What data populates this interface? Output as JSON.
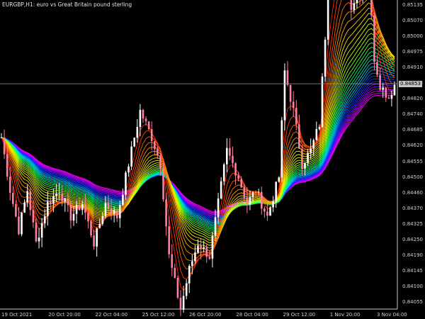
{
  "window": {
    "symbol_timeframe": "EURGBP,H1:",
    "description": "euro vs Great Britain pound sterling"
  },
  "current_price_label": "0.84853",
  "colors": {
    "background": "#000000",
    "axis": "#c8c8c8",
    "text": "#d0d0d0",
    "bull_candle": "#ffffff",
    "bear_candle": "#ff7f9f",
    "ribbon": [
      "#ff00ff",
      "#9900ff",
      "#0033ff",
      "#00ccff",
      "#00ff66",
      "#aaff00",
      "#ffee00",
      "#ff8800",
      "#ff2200"
    ]
  },
  "chart_data": {
    "type": "candlestick_with_ma_ribbon",
    "y_range": [
      0.84,
      0.8517
    ],
    "price_ticks": [
      "0.85135",
      "0.85070",
      "0.85000",
      "0.84975",
      "0.84910",
      "0.84853",
      "0.84820",
      "0.84740",
      "0.84685",
      "0.84620",
      "0.84555",
      "0.84500",
      "0.84460",
      "0.84370",
      "0.84325",
      "0.84250",
      "0.84190",
      "0.84145",
      "0.84100",
      "0.84055"
    ],
    "time_ticks": [
      "19 Oct 2021",
      "20 Oct 20:00",
      "22 Oct 04:00",
      "25 Oct 12:00",
      "26 Oct 20:00",
      "28 Oct 04:00",
      "29 Oct 12:00",
      "1 Nov 20:00",
      "3 Nov 04:00"
    ],
    "current_price": 0.84853,
    "price_path": [
      [
        0,
        0.8465
      ],
      [
        3,
        0.8445
      ],
      [
        6,
        0.843
      ],
      [
        9,
        0.8445
      ],
      [
        12,
        0.8425
      ],
      [
        16,
        0.844
      ],
      [
        20,
        0.8445
      ],
      [
        24,
        0.8435
      ],
      [
        28,
        0.844
      ],
      [
        32,
        0.8425
      ],
      [
        36,
        0.844
      ],
      [
        40,
        0.8435
      ],
      [
        44,
        0.8455
      ],
      [
        48,
        0.8475
      ],
      [
        52,
        0.8465
      ],
      [
        55,
        0.8455
      ],
      [
        58,
        0.842
      ],
      [
        62,
        0.84
      ],
      [
        65,
        0.8415
      ],
      [
        68,
        0.8425
      ],
      [
        72,
        0.842
      ],
      [
        75,
        0.844
      ],
      [
        78,
        0.846
      ],
      [
        82,
        0.845
      ],
      [
        85,
        0.844
      ],
      [
        88,
        0.8445
      ],
      [
        92,
        0.8435
      ],
      [
        96,
        0.845
      ],
      [
        98,
        0.849
      ],
      [
        101,
        0.8475
      ],
      [
        104,
        0.8455
      ],
      [
        107,
        0.846
      ],
      [
        110,
        0.847
      ],
      [
        113,
        0.852
      ],
      [
        116,
        0.8535
      ],
      [
        118,
        0.853
      ],
      [
        121,
        0.8515
      ],
      [
        124,
        0.852
      ],
      [
        127,
        0.8525
      ],
      [
        129,
        0.8495
      ],
      [
        131,
        0.8485
      ],
      [
        134,
        0.848
      ],
      [
        136,
        0.8485
      ]
    ]
  }
}
